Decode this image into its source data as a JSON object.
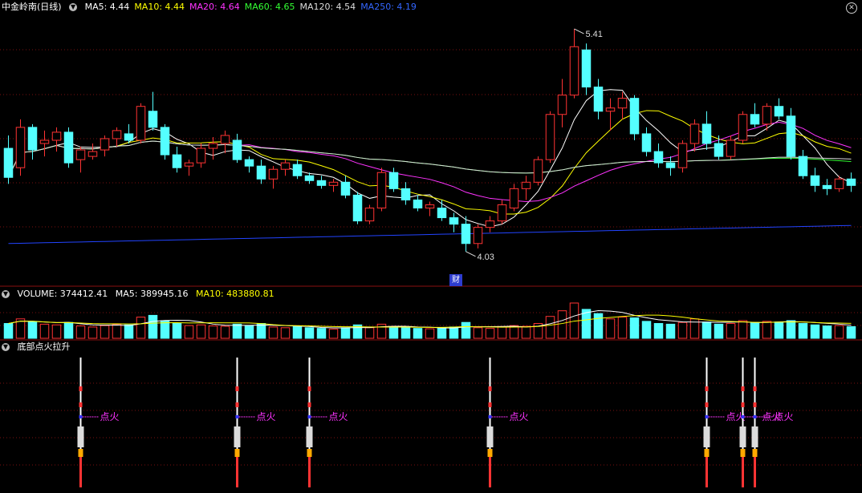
{
  "header": {
    "title": "中金岭南(日线)",
    "ma_labels": [
      {
        "text": "MA5: 4.44",
        "color": "#ffffff"
      },
      {
        "text": "MA10: 4.44",
        "color": "#ffff00"
      },
      {
        "text": "MA20: 4.64",
        "color": "#ff33ff"
      },
      {
        "text": "MA60: 4.65",
        "color": "#33ff33"
      },
      {
        "text": "MA120: 4.54",
        "color": "#dddddd"
      },
      {
        "text": "MA250: 4.19",
        "color": "#3366ff"
      }
    ],
    "close_icon": "close-icon"
  },
  "volume_header": {
    "label": "VOLUME: 374412.41",
    "ma5": "MA5: 389945.16",
    "ma10": "MA10: 483880.81"
  },
  "indicator_header": {
    "label": "底部点火拉升"
  },
  "finance_badge": "财",
  "colors": {
    "up": "#ff3333",
    "down": "#54ffff",
    "grid": "#7a1010",
    "ma5": "#ffffff",
    "ma10": "#ffff00",
    "ma20": "#ff33ff",
    "ma60": "#33ff33",
    "ma120": "#dddddd",
    "ma250": "#2244ff",
    "signal_text": "#ff33ff"
  },
  "chart_data": {
    "type": "candlestick",
    "price_range": [
      3.9,
      5.5
    ],
    "annotations": {
      "high": "5.41",
      "low": "4.03"
    },
    "candles": [
      [
        4.67,
        4.75,
        4.45,
        4.49
      ],
      [
        4.55,
        4.85,
        4.5,
        4.8
      ],
      [
        4.8,
        4.82,
        4.6,
        4.66
      ],
      [
        4.7,
        4.78,
        4.62,
        4.72
      ],
      [
        4.72,
        4.8,
        4.65,
        4.77
      ],
      [
        4.77,
        4.8,
        4.55,
        4.58
      ],
      [
        4.6,
        4.68,
        4.52,
        4.66
      ],
      [
        4.62,
        4.7,
        4.6,
        4.65
      ],
      [
        4.66,
        4.75,
        4.62,
        4.73
      ],
      [
        4.73,
        4.8,
        4.68,
        4.78
      ],
      [
        4.76,
        4.82,
        4.7,
        4.72
      ],
      [
        4.72,
        4.95,
        4.7,
        4.93
      ],
      [
        4.9,
        5.02,
        4.78,
        4.8
      ],
      [
        4.8,
        4.82,
        4.6,
        4.63
      ],
      [
        4.63,
        4.68,
        4.52,
        4.55
      ],
      [
        4.56,
        4.6,
        4.5,
        4.58
      ],
      [
        4.58,
        4.7,
        4.55,
        4.67
      ],
      [
        4.67,
        4.74,
        4.6,
        4.7
      ],
      [
        4.7,
        4.78,
        4.64,
        4.75
      ],
      [
        4.72,
        4.76,
        4.58,
        4.6
      ],
      [
        4.6,
        4.62,
        4.52,
        4.56
      ],
      [
        4.56,
        4.6,
        4.45,
        4.48
      ],
      [
        4.48,
        4.56,
        4.42,
        4.54
      ],
      [
        4.54,
        4.6,
        4.5,
        4.58
      ],
      [
        4.57,
        4.6,
        4.48,
        4.5
      ],
      [
        4.5,
        4.52,
        4.45,
        4.47
      ],
      [
        4.47,
        4.5,
        4.42,
        4.44
      ],
      [
        4.44,
        4.48,
        4.4,
        4.46
      ],
      [
        4.46,
        4.5,
        4.36,
        4.38
      ],
      [
        4.38,
        4.4,
        4.2,
        4.22
      ],
      [
        4.22,
        4.32,
        4.2,
        4.3
      ],
      [
        4.3,
        4.55,
        4.28,
        4.52
      ],
      [
        4.52,
        4.55,
        4.4,
        4.42
      ],
      [
        4.42,
        4.46,
        4.32,
        4.35
      ],
      [
        4.35,
        4.38,
        4.28,
        4.3
      ],
      [
        4.3,
        4.34,
        4.25,
        4.32
      ],
      [
        4.3,
        4.35,
        4.22,
        4.24
      ],
      [
        4.24,
        4.27,
        4.15,
        4.2
      ],
      [
        4.2,
        4.25,
        4.03,
        4.08
      ],
      [
        4.08,
        4.2,
        4.05,
        4.18
      ],
      [
        4.18,
        4.25,
        4.15,
        4.22
      ],
      [
        4.22,
        4.35,
        4.2,
        4.32
      ],
      [
        4.3,
        4.45,
        4.28,
        4.42
      ],
      [
        4.42,
        4.5,
        4.35,
        4.46
      ],
      [
        4.46,
        4.62,
        4.44,
        4.6
      ],
      [
        4.6,
        4.9,
        4.58,
        4.88
      ],
      [
        4.88,
        5.1,
        4.8,
        5.0
      ],
      [
        5.0,
        5.41,
        4.98,
        5.3
      ],
      [
        5.28,
        5.32,
        5.0,
        5.05
      ],
      [
        5.05,
        5.1,
        4.85,
        4.9
      ],
      [
        4.9,
        4.98,
        4.78,
        4.92
      ],
      [
        4.92,
        5.02,
        4.85,
        4.98
      ],
      [
        4.98,
        5.0,
        4.72,
        4.76
      ],
      [
        4.76,
        4.8,
        4.62,
        4.65
      ],
      [
        4.65,
        4.7,
        4.55,
        4.58
      ],
      [
        4.58,
        4.62,
        4.5,
        4.55
      ],
      [
        4.55,
        4.72,
        4.52,
        4.7
      ],
      [
        4.7,
        4.85,
        4.65,
        4.82
      ],
      [
        4.82,
        4.9,
        4.66,
        4.7
      ],
      [
        4.7,
        4.75,
        4.6,
        4.62
      ],
      [
        4.62,
        4.75,
        4.6,
        4.72
      ],
      [
        4.72,
        4.9,
        4.7,
        4.88
      ],
      [
        4.88,
        4.95,
        4.8,
        4.82
      ],
      [
        4.82,
        4.95,
        4.78,
        4.93
      ],
      [
        4.93,
        4.98,
        4.85,
        4.87
      ],
      [
        4.87,
        4.92,
        4.6,
        4.62
      ],
      [
        4.62,
        4.66,
        4.48,
        4.5
      ],
      [
        4.5,
        4.55,
        4.4,
        4.44
      ],
      [
        4.44,
        4.48,
        4.38,
        4.42
      ],
      [
        4.42,
        4.5,
        4.4,
        4.48
      ],
      [
        4.48,
        4.52,
        4.4,
        4.44
      ]
    ],
    "volume": [
      0.42,
      0.55,
      0.48,
      0.4,
      0.38,
      0.45,
      0.35,
      0.32,
      0.36,
      0.4,
      0.38,
      0.6,
      0.65,
      0.5,
      0.42,
      0.36,
      0.38,
      0.35,
      0.34,
      0.4,
      0.36,
      0.42,
      0.32,
      0.3,
      0.34,
      0.3,
      0.28,
      0.26,
      0.3,
      0.38,
      0.3,
      0.4,
      0.32,
      0.3,
      0.28,
      0.27,
      0.3,
      0.32,
      0.45,
      0.3,
      0.28,
      0.32,
      0.36,
      0.34,
      0.42,
      0.62,
      0.78,
      1.0,
      0.82,
      0.7,
      0.55,
      0.6,
      0.58,
      0.48,
      0.42,
      0.4,
      0.45,
      0.55,
      0.46,
      0.4,
      0.42,
      0.5,
      0.45,
      0.48,
      0.46,
      0.5,
      0.42,
      0.38,
      0.35,
      0.36,
      0.33
    ],
    "volume_scale": [
      0,
      1
    ],
    "signal_days": [
      18,
      28,
      29,
      29,
      30,
      30,
      31,
      32,
      33,
      33,
      34,
      35,
      37
    ],
    "signal_label": "点火",
    "signal_labels_text": [
      "点火",
      "点火",
      "点火",
      "点火",
      "点火",
      "点火",
      "点火"
    ]
  }
}
